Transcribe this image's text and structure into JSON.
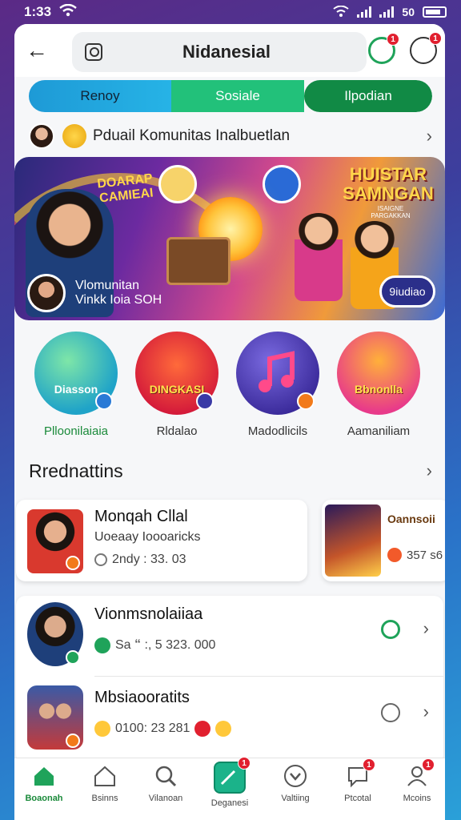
{
  "status_bar": {
    "time": "1:33",
    "battery_text": "50"
  },
  "top_bar": {
    "title": "Nidanesial",
    "chat_badge": "1",
    "profile_badge": "1"
  },
  "tabs": [
    {
      "label": "Renoy"
    },
    {
      "label": "Sosiale"
    },
    {
      "label": "Ilpodian"
    }
  ],
  "community": {
    "text": "Pduail Komunitas Inalbuetlan"
  },
  "banner": {
    "left_text": "DOARAP CAMIEAI",
    "right_title": "HUISTAR SAMNGAN",
    "right_sub": "ISAIGNE PARGAKKAN",
    "caption_line1": "Vlomunitan",
    "caption_line2": "Vinkk Ioia SOH",
    "button_label": "9iudiao"
  },
  "categories": [
    {
      "label": "Plloonilaiaia",
      "inner": "Diasson"
    },
    {
      "label": "Rldalao",
      "inner": "DINGKASI"
    },
    {
      "label": "Madodlicils",
      "inner": ""
    },
    {
      "label": "Aamaniliam",
      "inner": "Bbnonlla"
    }
  ],
  "section": {
    "title": "Rrednattins"
  },
  "rec_card": {
    "name": "Monqah Cllal",
    "sub": "Uoeaay Ioooaricks",
    "meta": "2ndy : 33. 03"
  },
  "rec_card2": {
    "title": "Oannsoii",
    "meta": "357 s6"
  },
  "list_items": [
    {
      "title": "Vionmsnolaiiaa",
      "meta": "Sa 🙶 :, 5  323. 000"
    },
    {
      "title": "Mbsiaooratits",
      "meta": "0100: 23 281"
    }
  ],
  "bottom_nav": [
    {
      "label": "Boaonah",
      "icon": "home-icon",
      "active": true
    },
    {
      "label": "Bsinns",
      "icon": "house-outline-icon"
    },
    {
      "label": "Vilanoan",
      "icon": "search-icon"
    },
    {
      "label": "Deganesi",
      "icon": "create-icon",
      "badge": "1"
    },
    {
      "label": "Valtiing",
      "icon": "heart-circle-icon"
    },
    {
      "label": "Ptcotal",
      "icon": "chat-icon",
      "badge": "1"
    },
    {
      "label": "Mcoins",
      "icon": "person-icon",
      "badge": "1"
    }
  ],
  "colors": {
    "brand_green": "#1fa35a",
    "accent_blue": "#1e9ad6",
    "badge_red": "#e1202f"
  }
}
